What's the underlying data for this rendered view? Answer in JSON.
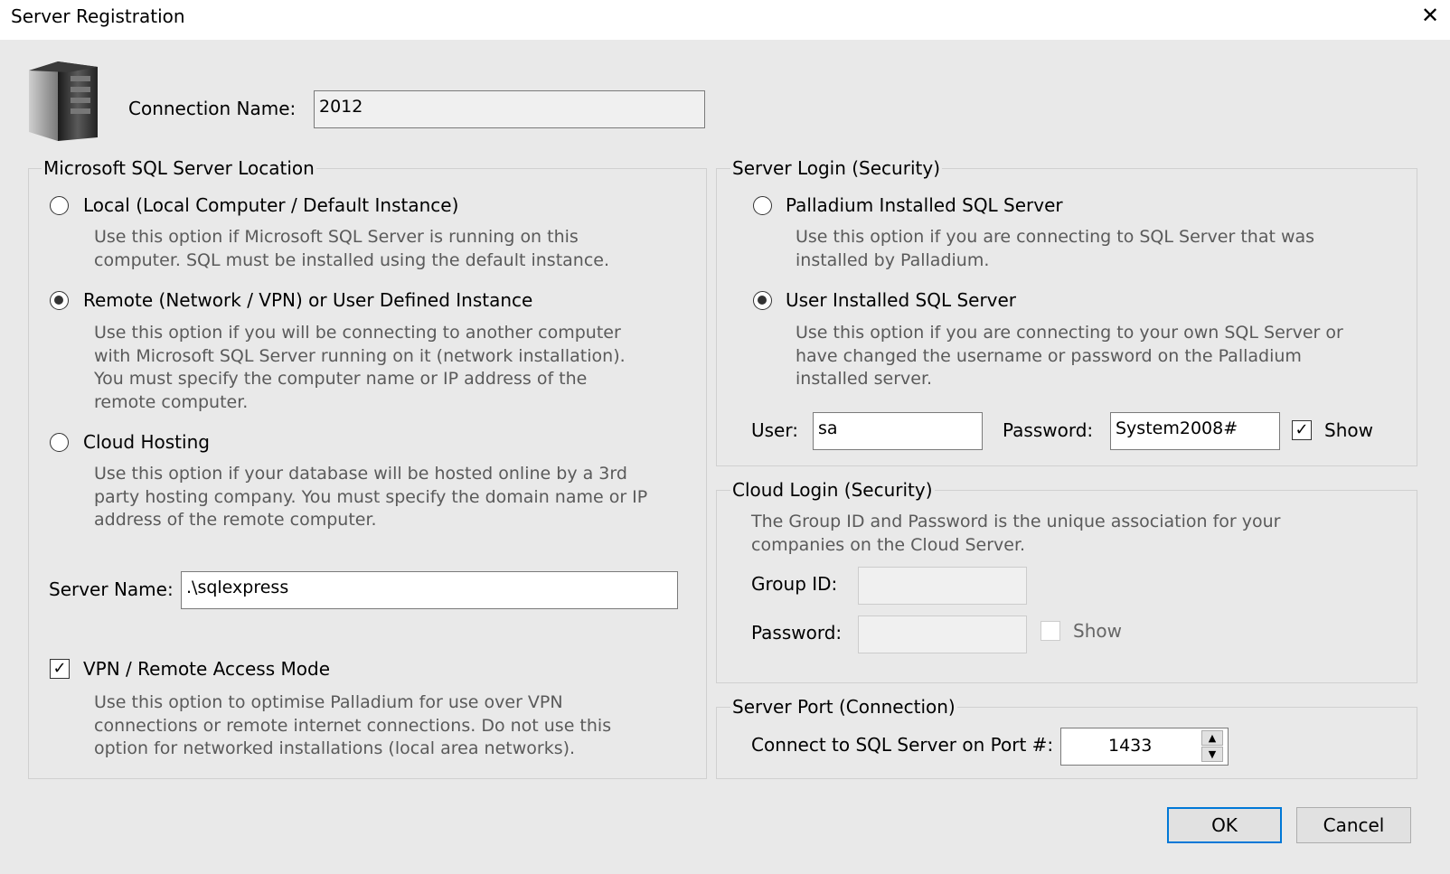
{
  "window": {
    "title": "Server Registration",
    "close_glyph": "✕"
  },
  "connection": {
    "label": "Connection Name:",
    "value": "2012"
  },
  "location": {
    "title": "Microsoft SQL Server Location",
    "options": [
      {
        "label": "Local (Local Computer / Default Instance)",
        "desc": [
          "Use this option if Microsoft SQL Server is running on this",
          "computer. SQL must be installed using the default instance."
        ],
        "selected": false
      },
      {
        "label": "Remote (Network / VPN) or User Defined Instance",
        "desc": [
          "Use this option if you will be connecting to another computer",
          "with Microsoft SQL Server running on it (network installation).",
          "You must specify the computer name or IP address of the",
          "remote computer."
        ],
        "selected": true
      },
      {
        "label": "Cloud Hosting",
        "desc": [
          "Use this option if your database will be hosted online by a 3rd",
          "party hosting company. You must specify the domain name or IP",
          "address of the remote computer."
        ],
        "selected": false
      }
    ],
    "server_name_label": "Server Name:",
    "server_name_value": ".\\sqlexpress",
    "vpn": {
      "label": "VPN / Remote Access Mode",
      "checked": true,
      "desc": [
        "Use this option to optimise Palladium for use over VPN",
        "connections or remote internet connections. Do not use this",
        "option for networked installations (local area networks)."
      ]
    }
  },
  "login": {
    "title": "Server Login (Security)",
    "options": [
      {
        "label": "Palladium Installed SQL Server",
        "desc": [
          "Use this option if you are connecting to SQL Server that was",
          "installed by Palladium."
        ],
        "selected": false
      },
      {
        "label": "User Installed SQL Server",
        "desc": [
          "Use this option if you are connecting to your own SQL Server or",
          "have changed the username or password on the Palladium",
          "installed server."
        ],
        "selected": true
      }
    ],
    "user_label": "User:",
    "user_value": "sa",
    "password_label": "Password:",
    "password_value": "System2008#",
    "show_label": "Show",
    "show_checked": true
  },
  "cloud": {
    "title": "Cloud Login (Security)",
    "desc": [
      "The Group ID and Password is the unique association for your",
      "companies on the Cloud Server."
    ],
    "group_label": "Group ID:",
    "group_value": "",
    "password_label": "Password:",
    "password_value": "",
    "show_label": "Show",
    "show_checked": false
  },
  "port": {
    "title": "Server Port (Connection)",
    "label": "Connect to SQL Server on Port #:",
    "value": "1433",
    "up_glyph": "▲",
    "down_glyph": "▼"
  },
  "buttons": {
    "ok": "OK",
    "cancel": "Cancel"
  },
  "colors": {
    "accent": "#0078d7",
    "background": "#e9e9e9",
    "description_text": "#5a5a5a"
  }
}
